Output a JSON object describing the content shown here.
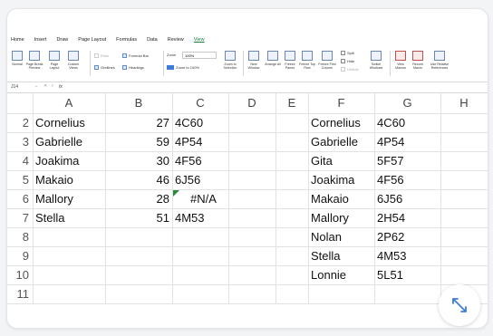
{
  "ribbon_tabs": [
    "Home",
    "Insert",
    "Draw",
    "Page Layout",
    "Formulas",
    "Data",
    "Review",
    "View"
  ],
  "active_tab": "View",
  "ribbon": {
    "normal": "Normal",
    "page_break": "Page Break Preview",
    "page_layout": "Page Layout",
    "custom_views": "Custom Views",
    "ruler": "Ruler",
    "formula_bar": "Formula Bar",
    "gridlines": "Gridlines",
    "headings": "Headings",
    "zoom_label": "Zoom",
    "zoom_value": "100%",
    "zoom_to_100": "Zoom to 100%",
    "zoom_to_selection": "Zoom to Selection",
    "new_window": "New Window",
    "arrange_all": "Arrange All",
    "freeze_panes": "Freeze Panes",
    "freeze_top_row": "Freeze Top Row",
    "freeze_first_column": "Freeze First Column",
    "split": "Split",
    "hide": "Hide",
    "unhide": "Unhide",
    "switch_windows": "Switch Windows",
    "view_macros": "View Macros",
    "record_macro": "Record Macro",
    "use_relative": "Use Relative References"
  },
  "formula_bar": {
    "cell_ref": "J14",
    "fx": "fx",
    "value": ""
  },
  "columns": [
    "A",
    "B",
    "C",
    "D",
    "E",
    "F",
    "G",
    "H"
  ],
  "rows": [
    {
      "num": "2",
      "A": "Cornelius",
      "B": "27",
      "C": "4C60",
      "F": "Cornelius",
      "G": "4C60"
    },
    {
      "num": "3",
      "A": "Gabrielle",
      "B": "59",
      "C": "4P54",
      "F": "Gabrielle",
      "G": "4P54"
    },
    {
      "num": "4",
      "A": "Joakima",
      "B": "30",
      "C": "4F56",
      "F": "Gita",
      "G": "5F57"
    },
    {
      "num": "5",
      "A": "Makaio",
      "B": "46",
      "C": "6J56",
      "F": "Joakima",
      "G": "4F56"
    },
    {
      "num": "6",
      "A": "Mallory",
      "B": "28",
      "C": "#N/A",
      "F": "Makaio",
      "G": "6J56"
    },
    {
      "num": "7",
      "A": "Stella",
      "B": "51",
      "C": "4M53",
      "F": "Mallory",
      "G": "2H54"
    },
    {
      "num": "8",
      "A": "",
      "B": "",
      "C": "",
      "F": "Nolan",
      "G": "2P62"
    },
    {
      "num": "9",
      "A": "",
      "B": "",
      "C": "",
      "F": "Stella",
      "G": "4M53"
    },
    {
      "num": "10",
      "A": "",
      "B": "",
      "C": "",
      "F": "Lonnie",
      "G": "5L51"
    },
    {
      "num": "11",
      "A": "",
      "B": "",
      "C": "",
      "F": "",
      "G": ""
    }
  ],
  "colors": {
    "accent": "#1a7a3a",
    "error_marker": "#2a8a3a",
    "expand_icon": "#3b7dd8"
  }
}
